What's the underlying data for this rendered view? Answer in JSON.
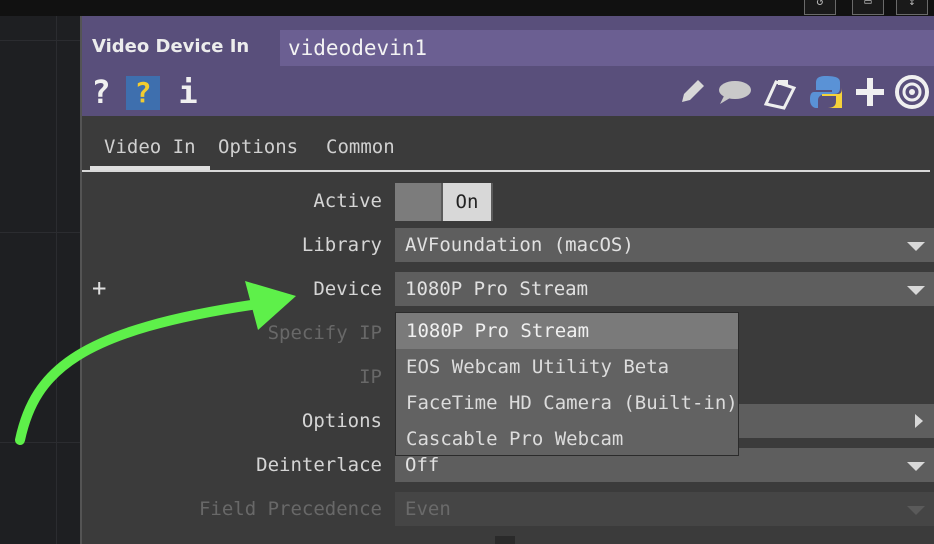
{
  "window": {
    "buttons": [
      "↺",
      "▭",
      "↕"
    ]
  },
  "operator": {
    "type": "Video Device In",
    "name": "videodevin1"
  },
  "header_icons": {
    "help": "?",
    "python_help": "?",
    "info": "i",
    "icon_names": [
      "help-icon",
      "python-help-icon",
      "info-icon",
      "pencil-icon",
      "comment-icon",
      "clipboard-icon",
      "python-icon",
      "plus-icon",
      "target-icon"
    ]
  },
  "tabs": [
    {
      "label": "Video In",
      "active": true
    },
    {
      "label": "Options",
      "active": false
    },
    {
      "label": "Common",
      "active": false
    }
  ],
  "params": {
    "active": {
      "label": "Active",
      "value": "On"
    },
    "library": {
      "label": "Library",
      "value": "AVFoundation (macOS)"
    },
    "device": {
      "label": "Device",
      "value": "1080P Pro Stream"
    },
    "specify_ip": {
      "label": "Specify IP"
    },
    "ip": {
      "label": "IP"
    },
    "options": {
      "label": "Options"
    },
    "deinterlace": {
      "label": "Deinterlace",
      "value": "Off"
    },
    "field_precedence": {
      "label": "Field Precedence",
      "value": "Even"
    }
  },
  "device_menu": {
    "options": [
      "1080P Pro Stream",
      "EOS Webcam Utility Beta",
      "FaceTime HD Camera (Built-in)",
      "Cascable Pro Webcam"
    ],
    "selected": "1080P Pro Stream"
  },
  "annotation": {
    "plus": "+",
    "arrow_color": "#5ef04a"
  },
  "colors": {
    "header": "#594f7b",
    "name_field": "#6b5f92",
    "panel": "#3b3b3b"
  }
}
